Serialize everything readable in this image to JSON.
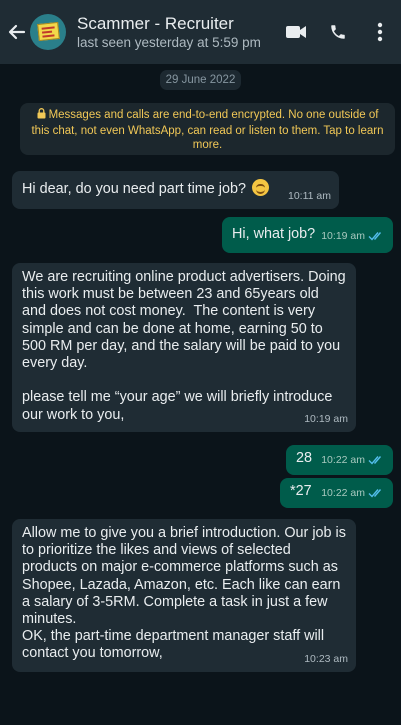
{
  "header": {
    "contact_name": "Scammer - Recruiter",
    "last_seen": "last seen yesterday at 5:59 pm",
    "icons": [
      "back-arrow-icon",
      "video-call-icon",
      "voice-call-icon",
      "more-options-icon"
    ]
  },
  "chat": {
    "date_chip": "29 June 2022",
    "encryption_notice": "Messages and calls are end-to-end encrypted. No one outside of this chat, not even WhatsApp, can read or listen to them. Tap to learn more.",
    "messages": [
      {
        "direction": "incoming",
        "text": "Hi dear, do you need part time job?",
        "emoji": "smiling-face",
        "time": "10:11 am"
      },
      {
        "direction": "outgoing",
        "text": "Hi, what job?",
        "time": "10:19 am",
        "status": "read"
      },
      {
        "direction": "incoming",
        "text": "We are recruiting online product advertisers. Doing this work must be between 23 and 65years old and does not cost money.  The content is very simple and can be done at home, earning 50 to 500 RM per day, and the salary will be paid to you every day.\n\nplease tell me “your age” we will briefly introduce our work to you,",
        "time": "10:19 am"
      },
      {
        "direction": "outgoing",
        "text": "28",
        "time": "10:22 am",
        "status": "read"
      },
      {
        "direction": "outgoing",
        "text": "*27",
        "time": "10:22 am",
        "status": "read"
      },
      {
        "direction": "incoming",
        "text": "Allow me to give you a brief introduction. Our job is to prioritize the likes and views of selected products on major e-commerce platforms such as Shopee, Lazada, Amazon, etc. Each like can earn a salary of 3-5RM. Complete a task in just a few minutes.\nOK, the part-time department manager staff will contact you tomorrow,",
        "time": "10:23 am"
      }
    ]
  },
  "colors": {
    "background": "#0b141a",
    "header": "#1f2c34",
    "incoming_bubble": "#1f2c34",
    "outgoing_bubble": "#005c4b",
    "encryption_text": "#f1c857",
    "read_ticks": "#53bdeb"
  }
}
